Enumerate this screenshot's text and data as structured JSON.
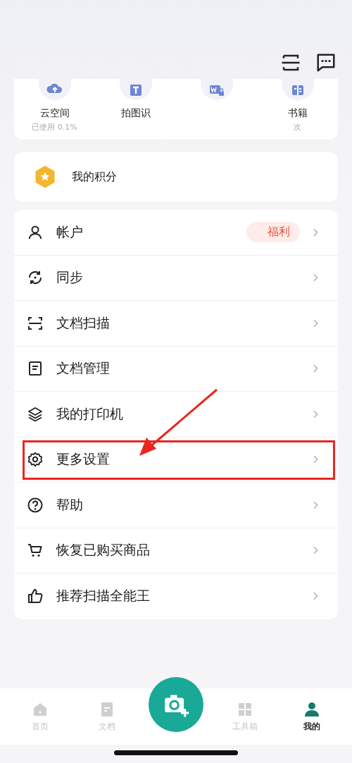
{
  "quick_access": [
    {
      "label": "云空间",
      "sub": "已使用 0.1%",
      "kind": "cloud"
    },
    {
      "label": "拍图识",
      "kind": "text"
    },
    {
      "kind": "word"
    },
    {
      "label": "书籍",
      "sub": "次",
      "kind": "book"
    }
  ],
  "points": {
    "label": "我的积分"
  },
  "menu": [
    {
      "label": "帐户",
      "kind": "person",
      "badge": "福利",
      "annotated": false
    },
    {
      "label": "同步",
      "kind": "sync",
      "annotated": false
    },
    {
      "label": "文档扫描",
      "kind": "scan",
      "annotated": false
    },
    {
      "label": "文档管理",
      "kind": "doc",
      "annotated": false
    },
    {
      "label": "我的打印机",
      "kind": "layers",
      "annotated": false
    },
    {
      "label": "更多设置",
      "kind": "gear",
      "annotated": true
    },
    {
      "label": "帮助",
      "kind": "help",
      "annotated": false
    },
    {
      "label": "恢复已购买商品",
      "kind": "cart",
      "annotated": false
    },
    {
      "label": "推荐扫描全能王",
      "kind": "thumb",
      "annotated": false
    }
  ],
  "tabs": [
    {
      "label": "首页",
      "kind": "home",
      "selected": false
    },
    {
      "label": "文档",
      "kind": "doc",
      "selected": false
    },
    {
      "kind": "camera",
      "selected": false
    },
    {
      "label": "工具箱",
      "kind": "grid",
      "selected": false
    },
    {
      "label": "我的",
      "kind": "person",
      "selected": true
    }
  ]
}
